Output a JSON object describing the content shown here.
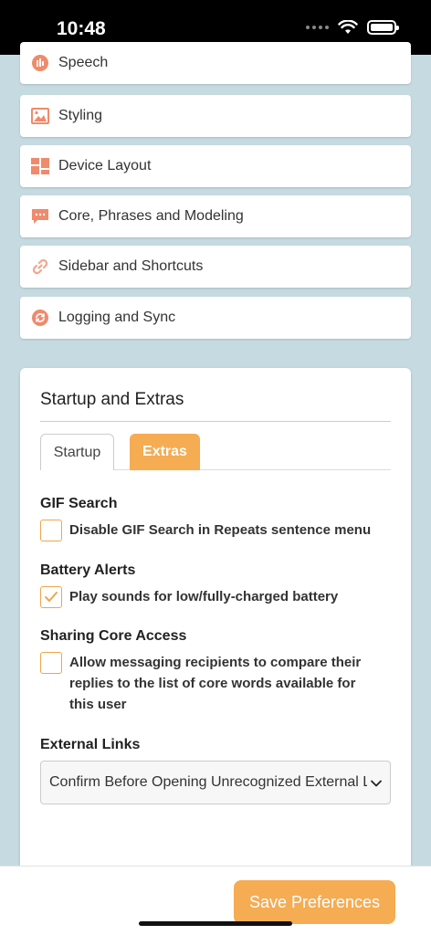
{
  "status_bar": {
    "time": "10:48"
  },
  "menu": {
    "items": [
      {
        "label": "Speech",
        "icon": "speech-icon"
      },
      {
        "label": "Styling",
        "icon": "image-icon"
      },
      {
        "label": "Device Layout",
        "icon": "layout-icon"
      },
      {
        "label": "Core, Phrases and Modeling",
        "icon": "chat-bubble-icon"
      },
      {
        "label": "Sidebar and Shortcuts",
        "icon": "link-icon"
      },
      {
        "label": "Logging and Sync",
        "icon": "sync-icon"
      }
    ]
  },
  "card": {
    "title": "Startup and Extras",
    "tabs": [
      {
        "label": "Startup",
        "active": false
      },
      {
        "label": "Extras",
        "active": true
      }
    ],
    "sections": {
      "gif": {
        "label": "GIF Search",
        "option": "Disable GIF Search in Repeats sentence menu",
        "checked": false
      },
      "battery": {
        "label": "Battery Alerts",
        "option": "Play sounds for low/fully-charged battery",
        "checked": true
      },
      "sharing": {
        "label": "Sharing Core Access",
        "option": "Allow messaging recipients to compare their replies to the list of core words available for this user",
        "checked": false
      },
      "links": {
        "label": "External Links",
        "selected": "Confirm Before Opening Unrecognized External Links"
      }
    }
  },
  "footer": {
    "save_label": "Save Preferences"
  },
  "colors": {
    "accent": "#f5ac53",
    "icon": "#f08a6c",
    "background": "#c6dbe1"
  }
}
